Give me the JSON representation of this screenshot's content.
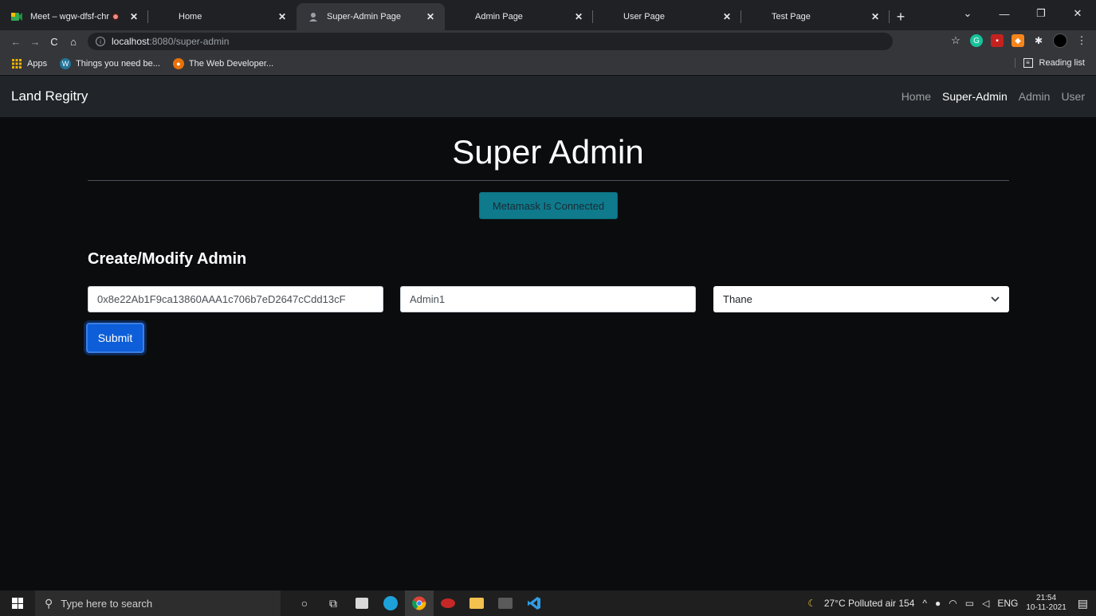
{
  "browser": {
    "tabs": [
      {
        "title": "Meet – wgw-dfsf-chr",
        "active": false,
        "recording": true
      },
      {
        "title": "Home",
        "active": false,
        "recording": false
      },
      {
        "title": "Super-Admin Page",
        "active": true,
        "recording": false
      },
      {
        "title": "Admin Page",
        "active": false,
        "recording": false
      },
      {
        "title": "User Page",
        "active": false,
        "recording": false
      },
      {
        "title": "Test Page",
        "active": false,
        "recording": false
      }
    ],
    "url_host": "localhost",
    "url_rest": ":8080/super-admin",
    "bookmarks": {
      "apps": "Apps",
      "item1": "Things you need be...",
      "item2": "The Web Developer..."
    },
    "reading_list": "Reading list"
  },
  "navbar": {
    "brand": "Land Regitry",
    "links": [
      "Home",
      "Super-Admin",
      "Admin",
      "User"
    ],
    "active": "Super-Admin"
  },
  "page": {
    "heading": "Super Admin",
    "status_button": "Metamask Is Connected",
    "section_title": "Create/Modify Admin",
    "address_value": "0x8e22Ab1F9ca13860AAA1c706b7eD2647cCdd13cF",
    "name_value": "Admin1",
    "city_selected": "Thane",
    "submit_label": "Submit"
  },
  "taskbar": {
    "search_placeholder": "Type here to search",
    "weather": "27°C  Polluted air 154",
    "lang": "ENG",
    "time": "21:54",
    "date": "10-11-2021"
  },
  "colors": {
    "status_button": "#0e7a8c",
    "submit": "#0d5ed8",
    "navbar": "#212529"
  }
}
